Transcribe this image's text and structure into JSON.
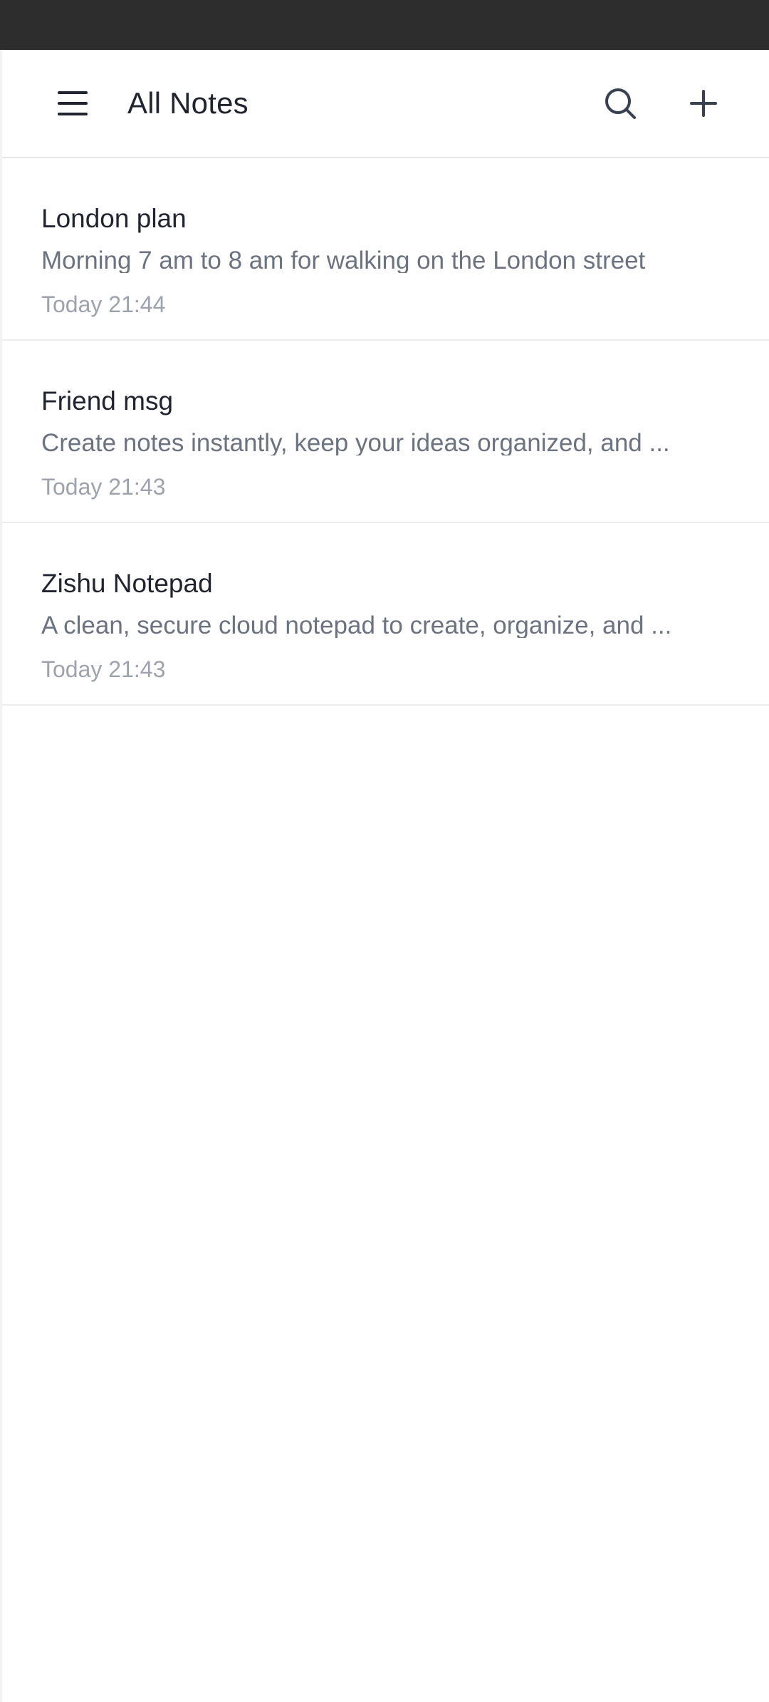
{
  "header": {
    "title": "All Notes",
    "menu_icon": "hamburger-menu-icon",
    "search_icon": "search-icon",
    "add_icon": "plus-icon"
  },
  "notes": [
    {
      "title": "London plan",
      "preview": "Morning 7 am to 8 am for walking on the London street",
      "time": "Today 21:44"
    },
    {
      "title": "Friend msg",
      "preview": "Create notes instantly, keep your ideas organized, and ...",
      "time": "Today 21:43"
    },
    {
      "title": "Zishu Notepad",
      "preview": "A clean, secure cloud notepad to create, organize, and ...",
      "time": "Today 21:43"
    }
  ],
  "colors": {
    "status_bar": "#2d2d2d",
    "title_text": "#1f2430",
    "preview_text": "#6b7280",
    "time_text": "#9ca3af",
    "divider": "#ececec"
  }
}
